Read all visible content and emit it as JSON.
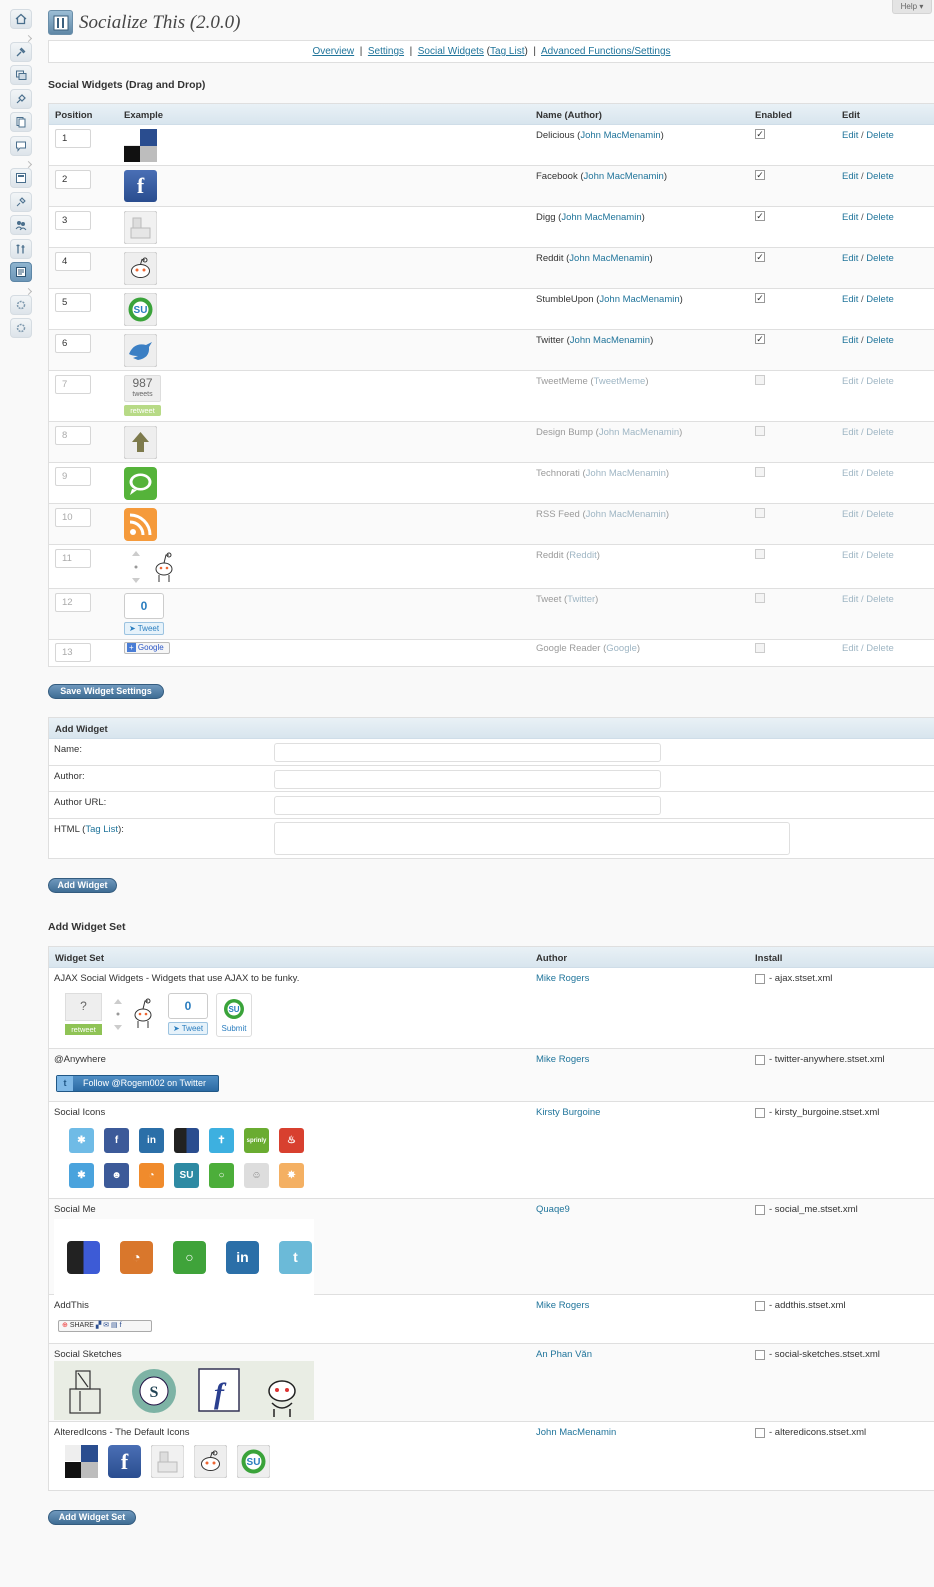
{
  "help_label": "Help",
  "app_title": "Socialize This (2.0.0)",
  "subnav": {
    "overview": "Overview",
    "settings": "Settings",
    "social_widgets": "Social Widgets",
    "tag_list": "Tag List",
    "advanced": "Advanced Functions/Settings",
    "sep": "|"
  },
  "widgets_section": {
    "title": "Social Widgets (Drag and Drop)",
    "columns": [
      "Position",
      "Example",
      "Name (Author)",
      "Enabled",
      "Edit"
    ],
    "edit_label": "Edit",
    "delete_label": "Delete",
    "rows": [
      {
        "position": "1",
        "name": "Delicious",
        "author": "John MacMenamin",
        "enabled": true,
        "icon": "delicious-icon"
      },
      {
        "position": "2",
        "name": "Facebook",
        "author": "John MacMenamin",
        "enabled": true,
        "icon": "facebook-icon"
      },
      {
        "position": "3",
        "name": "Digg",
        "author": "John MacMenamin",
        "enabled": true,
        "icon": "digg-icon"
      },
      {
        "position": "4",
        "name": "Reddit",
        "author": "John MacMenamin",
        "enabled": true,
        "icon": "reddit-icon"
      },
      {
        "position": "5",
        "name": "StumbleUpon",
        "author": "John MacMenamin",
        "enabled": true,
        "icon": "stumbleupon-icon"
      },
      {
        "position": "6",
        "name": "Twitter",
        "author": "John MacMenamin",
        "enabled": true,
        "icon": "twitter-icon"
      },
      {
        "position": "7",
        "name": "TweetMeme",
        "author": "TweetMeme",
        "enabled": false,
        "icon": "tweetmeme-icon",
        "count": "987",
        "count_label": "tweets",
        "badge": "retweet"
      },
      {
        "position": "8",
        "name": "Design Bump",
        "author": "John MacMenamin",
        "enabled": false,
        "icon": "designbump-icon"
      },
      {
        "position": "9",
        "name": "Technorati",
        "author": "John MacMenamin",
        "enabled": false,
        "icon": "technorati-icon"
      },
      {
        "position": "10",
        "name": "RSS Feed",
        "author": "John MacMenamin",
        "enabled": false,
        "icon": "rss-icon"
      },
      {
        "position": "11",
        "name": "Reddit",
        "author": "Reddit",
        "enabled": false,
        "icon": "reddit-vote-icon"
      },
      {
        "position": "12",
        "name": "Tweet",
        "author": "Twitter",
        "enabled": false,
        "icon": "tweet-button-icon",
        "count": "0",
        "button": "Tweet"
      },
      {
        "position": "13",
        "name": "Google Reader",
        "author": "Google",
        "enabled": false,
        "icon": "google-reader-icon",
        "button": "Google"
      }
    ],
    "save_button": "Save Widget Settings"
  },
  "add_widget": {
    "header": "Add Widget",
    "name_label": "Name:",
    "author_label": "Author:",
    "author_url_label": "Author URL:",
    "html_label_prefix": "HTML (",
    "html_label_link": "Tag List",
    "html_label_suffix": "):",
    "button": "Add Widget"
  },
  "widget_sets": {
    "title": "Add Widget Set",
    "columns": [
      "Widget Set",
      "Author",
      "Install"
    ],
    "rows": [
      {
        "name": "AJAX Social Widgets - Widgets that use AJAX to be funky.",
        "author": "Mike Rogers",
        "file": "- ajax.stset.xml"
      },
      {
        "name": "@Anywhere",
        "author": "Mike Rogers",
        "file": "- twitter-anywhere.stset.xml"
      },
      {
        "name": "Social Icons",
        "author": "Kirsty Burgoine",
        "file": "- kirsty_burgoine.stset.xml"
      },
      {
        "name": "Social Me",
        "author": "Quaqe9",
        "file": "- social_me.stset.xml"
      },
      {
        "name": "AddThis",
        "author": "Mike Rogers",
        "file": "- addthis.stset.xml"
      },
      {
        "name": "Social Sketches",
        "author": "An Phan Văn",
        "file": "- social-sketches.stset.xml"
      },
      {
        "name": "AlteredIcons - The Default Icons",
        "author": "John MacMenamin",
        "file": "- alteredicons.stset.xml"
      }
    ],
    "ajax_preview": {
      "count_q": "?",
      "retweet": "retweet",
      "count_zero": "0",
      "tweet": "Tweet",
      "submit": "Submit"
    },
    "anywhere_button": "Follow @Rogem002 on Twitter",
    "addthis_button": "SHARE",
    "spring_label": "sprinly",
    "button": "Add Widget Set"
  },
  "colors": {
    "link": "#21759b",
    "header_bg": "#e4edf3",
    "button": "#4f7ca3"
  }
}
